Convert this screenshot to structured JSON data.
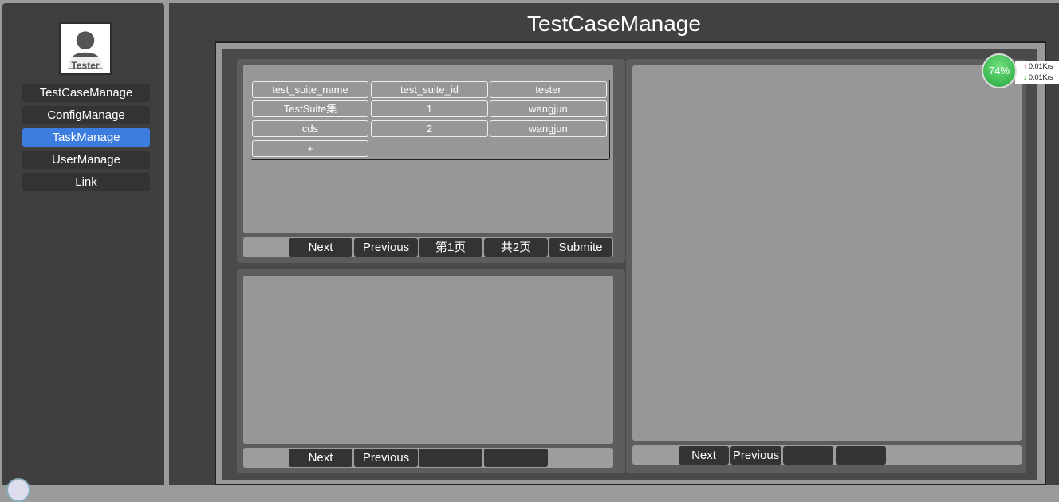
{
  "sidebar": {
    "avatar_label": "Tester",
    "items": [
      {
        "label": "TestCaseManage"
      },
      {
        "label": "ConfigManage"
      },
      {
        "label": "TaskManage",
        "active": true
      },
      {
        "label": "UserManage"
      },
      {
        "label": "Link"
      }
    ]
  },
  "main": {
    "title": "TestCaseManage",
    "suite_table": {
      "headers": [
        "test_suite_name",
        "test_suite_id",
        "tester"
      ],
      "rows": [
        [
          "TestSuite集",
          "1",
          "wangjun"
        ],
        [
          "cds",
          "2",
          "wangjun"
        ]
      ],
      "add_label": "+"
    },
    "top_pager": {
      "next": "Next",
      "previous": "Previous",
      "page": "第1页",
      "total": "共2页",
      "submit": "Submite"
    },
    "bottom_pager": {
      "next": "Next",
      "previous": "Previous"
    },
    "right_pager": {
      "next": "Next",
      "previous": "Previous"
    }
  },
  "net_widget": {
    "percent": "74%",
    "upload": "0.01K/s",
    "download": "0.01K/s"
  },
  "colors": {
    "accent": "#3d7de0",
    "sidebar": "#3f3f3f",
    "main": "#414141"
  }
}
